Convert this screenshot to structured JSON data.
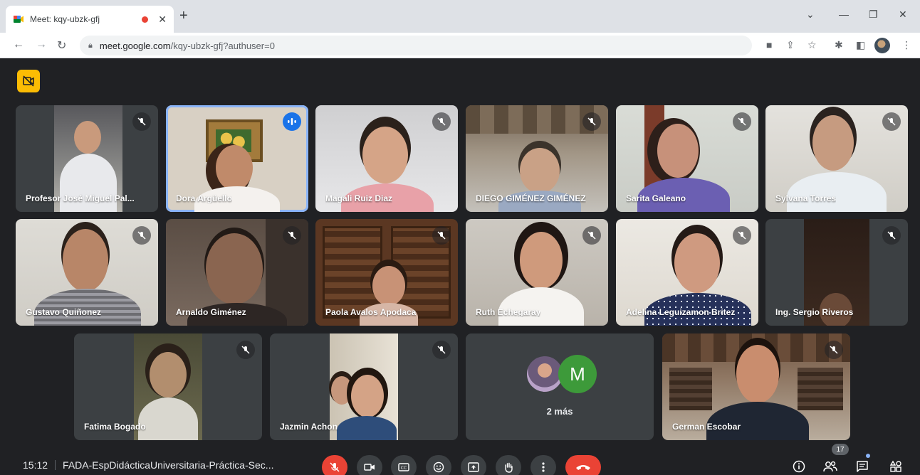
{
  "browser": {
    "tab_title": "Meet: kqy-ubzk-gfj",
    "url_host": "meet.google.com",
    "url_path": "/kqy-ubzk-gfj?authuser=0"
  },
  "meeting": {
    "time": "15:12",
    "title": "FADA-EspDidácticaUniversitaria-Práctica-Sec...",
    "participant_count": "17",
    "more_label": "2 más",
    "more_initial": "M"
  },
  "participants": [
    {
      "name": "Profesor José Miguel Pal..."
    },
    {
      "name": "Dora Argüello"
    },
    {
      "name": "Magali Ruiz Diaz"
    },
    {
      "name": "DIEGO GIMÉNEZ GIMÉNEZ"
    },
    {
      "name": "Sarita Galeano"
    },
    {
      "name": "Sylvana Torres"
    },
    {
      "name": "Gustavo Quiñonez"
    },
    {
      "name": "Arnaldo Giménez"
    },
    {
      "name": "Paola Avalos Apodaca"
    },
    {
      "name": "Ruth Echegaray"
    },
    {
      "name": "Adelina Leguizamon Britez"
    },
    {
      "name": "Ing. Sergio Riveros"
    },
    {
      "name": "Fatima Bogado"
    },
    {
      "name": "Jazmin Achon"
    },
    {
      "name": "German Escobar"
    }
  ],
  "colors": {
    "background": "#202124",
    "tile": "#3c4043",
    "accent": "#8ab4f8",
    "danger": "#ea4335",
    "layout_badge": "#fbbc04"
  },
  "icons": {
    "mic_off": "mic-off-icon",
    "speaking": "audio-wave-icon",
    "camera": "camera-icon",
    "captions": "captions-icon",
    "reactions": "emoji-icon",
    "present": "present-icon",
    "raise_hand": "hand-icon",
    "more": "more-vert-icon",
    "end_call": "phone-hangup-icon",
    "info": "info-icon",
    "people": "people-icon",
    "chat": "chat-icon",
    "activities": "activities-icon"
  }
}
